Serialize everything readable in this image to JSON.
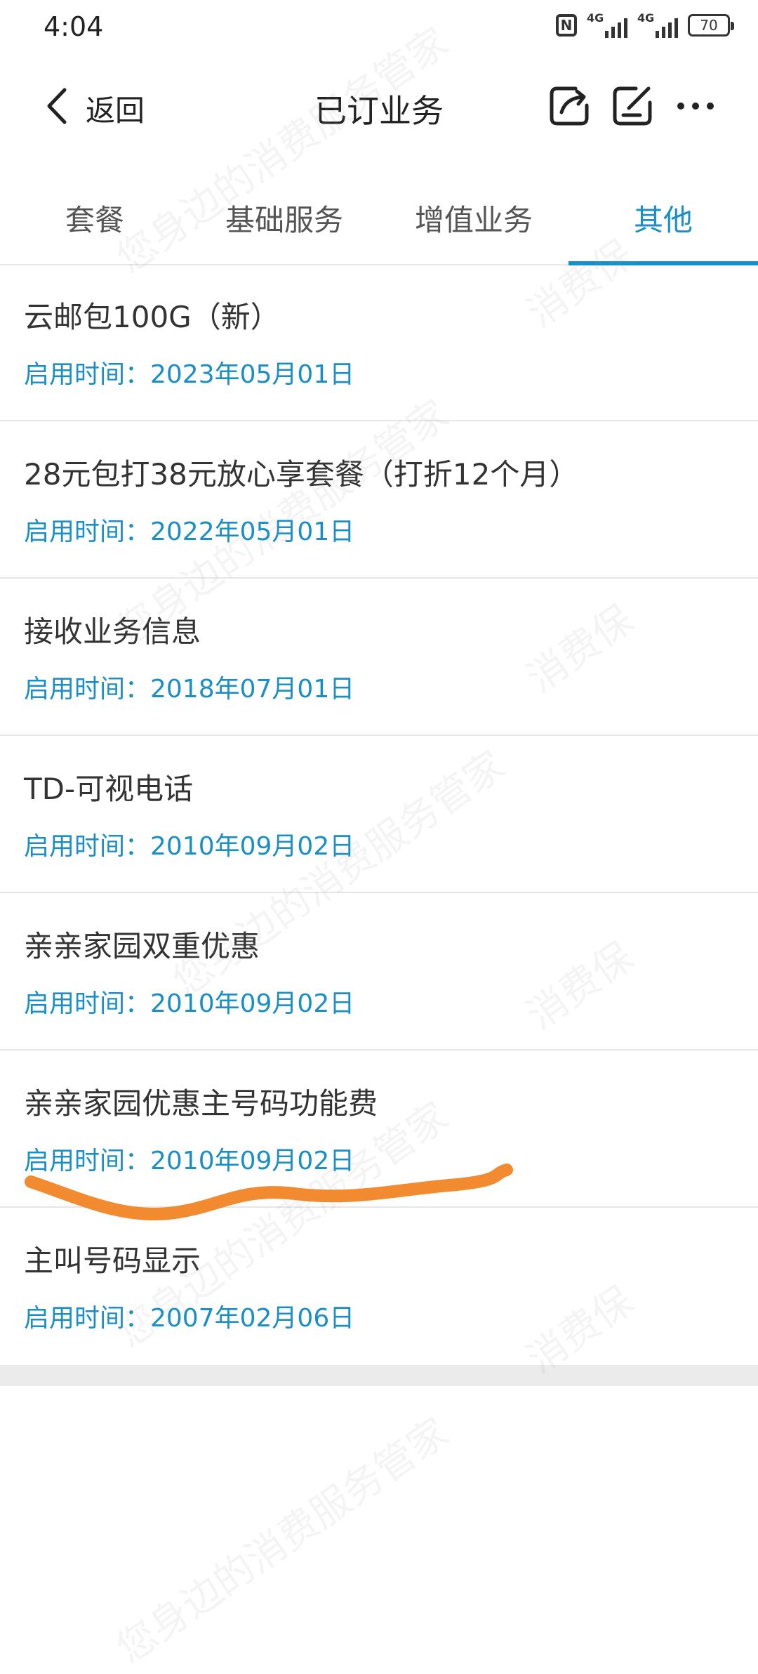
{
  "status_bar": {
    "time": "4:04",
    "network_1": "4G",
    "network_2": "4G",
    "battery": "70"
  },
  "header": {
    "back_label": "返回",
    "title": "已订业务"
  },
  "tabs": [
    {
      "label": "套餐",
      "active": false
    },
    {
      "label": "基础服务",
      "active": false
    },
    {
      "label": "增值业务",
      "active": false
    },
    {
      "label": "其他",
      "active": true
    }
  ],
  "items": [
    {
      "name": "云邮包100G（新）",
      "date": "启用时间：2023年05月01日"
    },
    {
      "name": "28元包打38元放心享套餐（打折12个月）",
      "date": "启用时间：2022年05月01日"
    },
    {
      "name": "接收业务信息",
      "date": "启用时间：2018年07月01日"
    },
    {
      "name": "TD-可视电话",
      "date": "启用时间：2010年09月02日"
    },
    {
      "name": "亲亲家园双重优惠",
      "date": "启用时间：2010年09月02日"
    },
    {
      "name": "亲亲家园优惠主号码功能费",
      "date": "启用时间：2010年09月02日"
    },
    {
      "name": "主叫号码显示",
      "date": "启用时间：2007年02月06日"
    }
  ],
  "watermark": {
    "text_a": "您身边的消费服务管家",
    "text_b": "消费保"
  },
  "colors": {
    "accent": "#1a8fc7",
    "annotation": "#f28a30"
  }
}
